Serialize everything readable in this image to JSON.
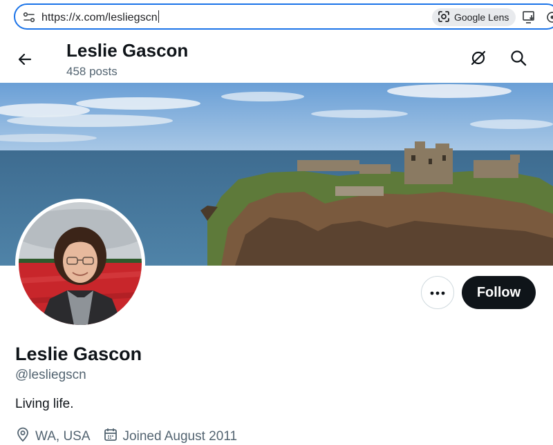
{
  "browser": {
    "url": "https://x.com/lesliegscn",
    "lens_label": "Google Lens",
    "icons": [
      "site-info-icon",
      "google-lens-icon",
      "install-app-icon",
      "extension-icon"
    ]
  },
  "header": {
    "name": "Leslie Gascon",
    "posts": "458 posts",
    "icons": [
      "back-arrow-icon",
      "grok-icon",
      "search-icon"
    ]
  },
  "banner": {
    "description_icon": "castle-coast-photo"
  },
  "actions": {
    "more_icon": "more-dots-icon",
    "follow_label": "Follow"
  },
  "profile": {
    "name": "Leslie Gascon",
    "handle": "@lesliegscn",
    "bio": "Living life.",
    "location": "WA, USA",
    "joined": "Joined August 2011"
  },
  "colors": {
    "accent": "#1a73e8",
    "text_primary": "#0f1419",
    "text_secondary": "#536471",
    "follow_bg": "#0f1419",
    "border": "#cfd9de"
  }
}
